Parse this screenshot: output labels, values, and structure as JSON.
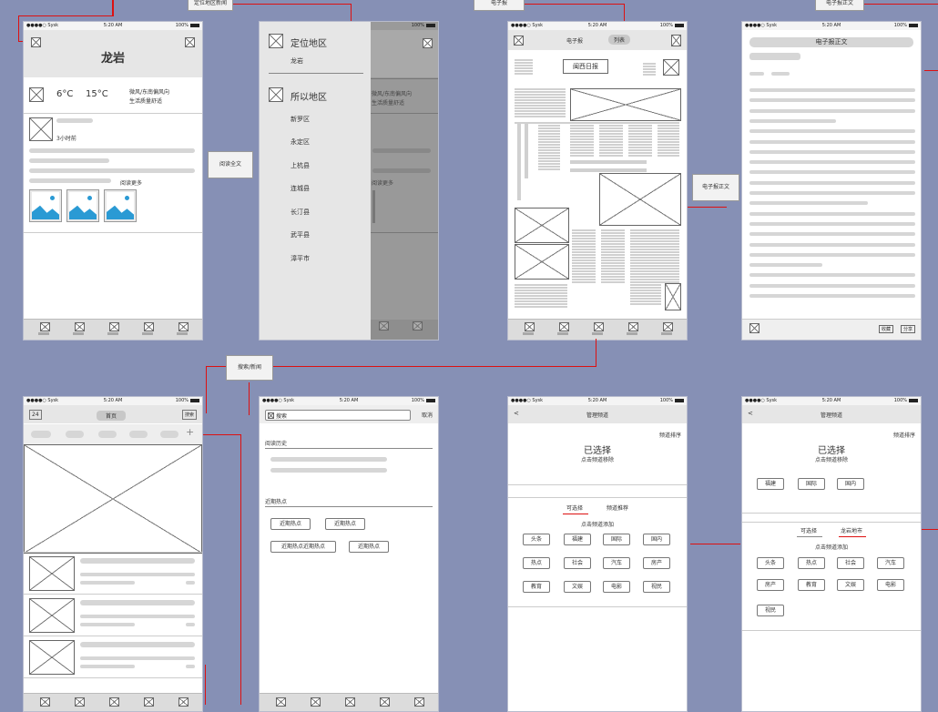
{
  "status": {
    "carrier": "●●●●○ Sysk",
    "time": "5:20 AM",
    "battery": "100%"
  },
  "labels": {
    "local_news": "定位地区新闻",
    "epaper": "电子报",
    "epaper_body_top": "电子报正文",
    "read_full": "阅读全文",
    "epaper_body_mid": "电子报正文",
    "search_link": "搜索/新闻"
  },
  "weather": {
    "city": "龙岩",
    "temp_low": "6°C",
    "temp_high": "15°C",
    "desc_1": "微风/东南偏风向",
    "desc_2": "生活质量舒适",
    "time_ago": "3小时前",
    "read_more": "阅读更多"
  },
  "districts": {
    "locate_title": "定位地区",
    "current": "龙岩",
    "area_title": "所以地区",
    "items": [
      "新罗区",
      "永定区",
      "上杭县",
      "连城县",
      "长汀县",
      "武平县",
      "漳平市"
    ],
    "under_1": "微风/东南偏风向",
    "under_2": "生活质量舒适",
    "under_more": "阅读更多"
  },
  "epaper_screen": {
    "seg_left": "电子报",
    "seg_right": "列表",
    "masthead": "闽西日报"
  },
  "article": {
    "title": "电子报正文",
    "btn_1": "收藏",
    "btn_2": "分享"
  },
  "home": {
    "badge": "24",
    "title": "首页",
    "right": "搜索"
  },
  "search": {
    "placeholder": "搜索",
    "cancel": "取消",
    "history": "阅读历史",
    "hot": "近期热点",
    "tags": [
      "近期热点",
      "近期热点",
      "近期热点近期热点",
      "近期热点"
    ]
  },
  "manage1": {
    "back": "<",
    "title": "管理频道",
    "done": "频道排序",
    "selected": "已选择",
    "hint": "点击频道移除",
    "tab_a": "可选择",
    "tab_b": "频道推荐",
    "sub_hint": "点击频道添加",
    "chips": [
      "头条",
      "福建",
      "国际",
      "国内",
      "热点",
      "社会",
      "汽车",
      "房产",
      "教育",
      "文娱",
      "电影",
      "视民"
    ]
  },
  "manage2": {
    "back": "<",
    "title": "管理频道",
    "done": "频道排序",
    "selected": "已选择",
    "hint": "点击频道移除",
    "sel_chips": [
      "福建",
      "国际",
      "国内"
    ],
    "tab_a": "可选择",
    "tab_b": "龙岩地市",
    "sub_hint": "点击频道添加",
    "chips": [
      "头条",
      "热点",
      "社会",
      "汽车",
      "房产",
      "教育",
      "文娱",
      "电影",
      "视民"
    ]
  },
  "colors": {
    "background": "#8690b5",
    "connector": "#dd1111",
    "accent": "#2a9ad4"
  }
}
